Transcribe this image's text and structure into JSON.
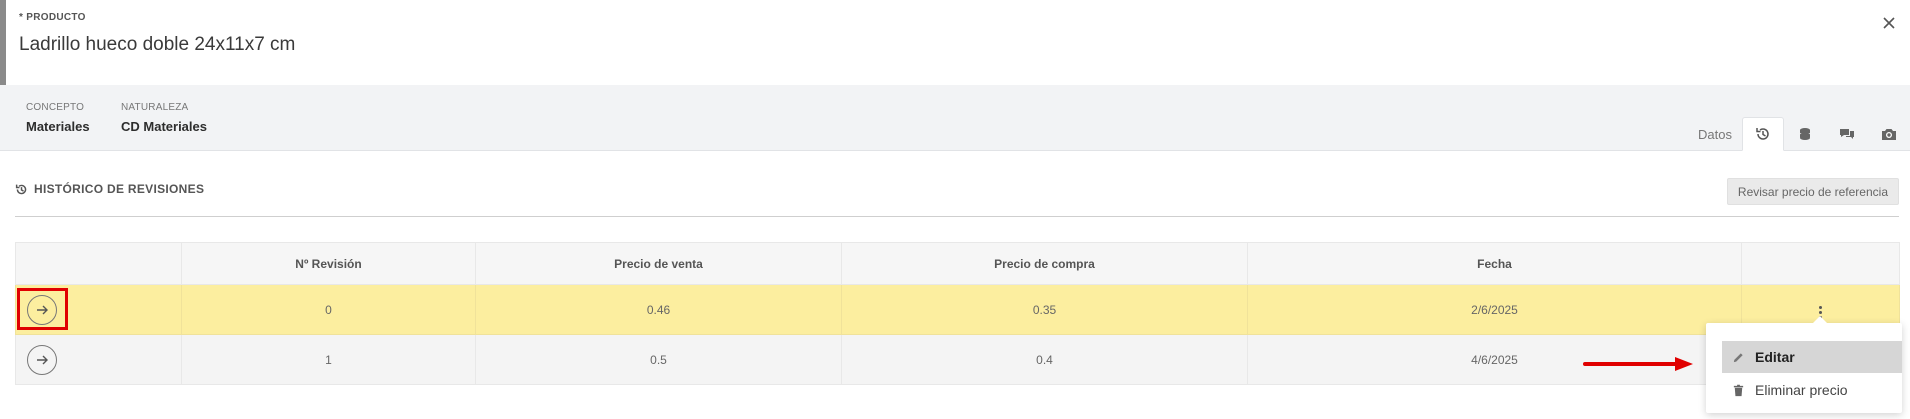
{
  "header": {
    "eyebrow": "* PRODUCTO",
    "title": "Ladrillo hueco doble 24x11x7 cm",
    "close_icon": "close-icon"
  },
  "meta": {
    "concepto_label": "CONCEPTO",
    "concepto_value": "Materiales",
    "naturaleza_label": "NATURALEZA",
    "naturaleza_value": "CD Materiales"
  },
  "tabs": [
    {
      "label": "Datos",
      "active": false
    },
    {
      "icon": "history-icon",
      "active": true
    },
    {
      "icon": "coins-icon",
      "active": false
    },
    {
      "icon": "comments-icon",
      "active": false
    },
    {
      "icon": "camera-icon",
      "active": false
    }
  ],
  "section": {
    "title": "HISTÓRICO DE REVISIONES",
    "icon": "history-icon",
    "button_label": "Revisar precio de referencia"
  },
  "table": {
    "columns": [
      "",
      "Nº Revisión",
      "Precio de venta",
      "Precio de compra",
      "Fecha",
      ""
    ],
    "rows": [
      {
        "revision": "0",
        "venta": "0.46",
        "compra": "0.35",
        "fecha": "2/6/2025",
        "highlighted": true
      },
      {
        "revision": "1",
        "venta": "0.5",
        "compra": "0.4",
        "fecha": "4/6/2025",
        "highlighted": false
      }
    ]
  },
  "context_menu": {
    "items": [
      {
        "label": "Editar",
        "icon": "pencil-icon",
        "active": true
      },
      {
        "label": "Eliminar precio",
        "icon": "trash-icon",
        "active": false
      }
    ]
  },
  "colors": {
    "highlight_row": "#fcee9f",
    "annotation_red": "#e00000",
    "accent_bar": "#8a8a8a"
  }
}
